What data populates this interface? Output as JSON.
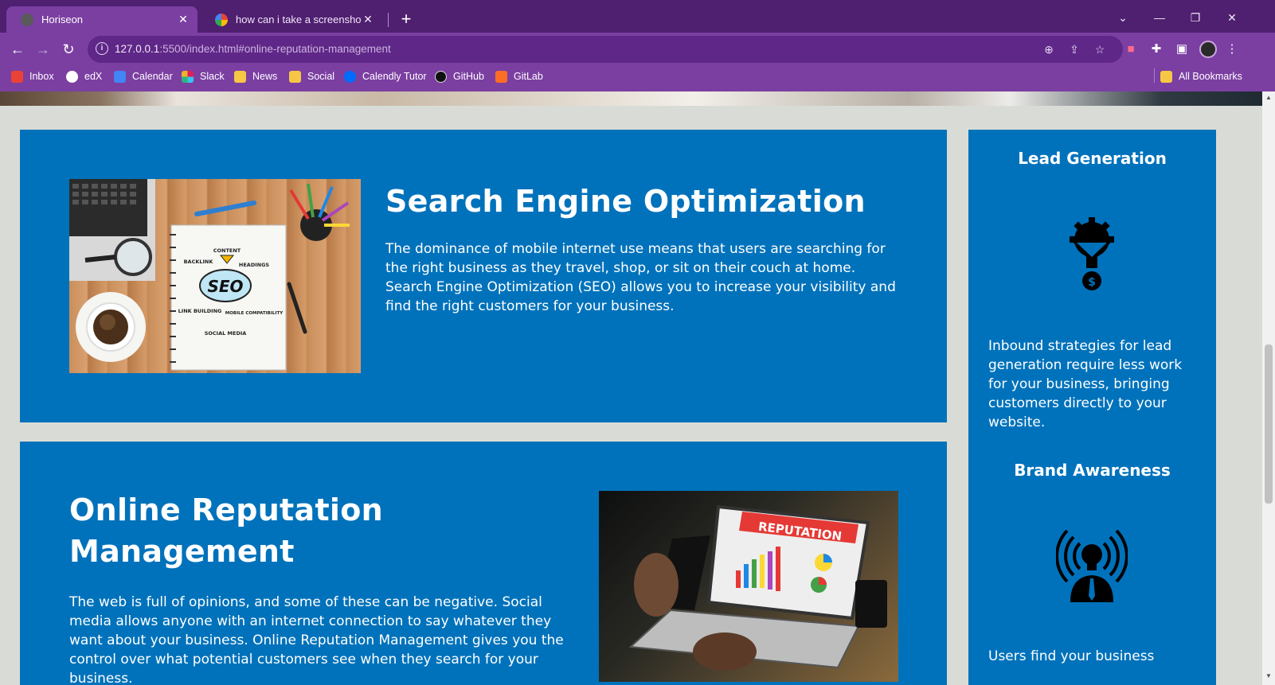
{
  "browser": {
    "tabs": [
      {
        "title": "Horiseon",
        "close": "✕",
        "active": true
      },
      {
        "title": "how can i take a screenshot of m",
        "close": "✕",
        "active": false
      }
    ],
    "new_tab": "+",
    "window_controls": {
      "dropdown": "⌄",
      "minimize": "—",
      "restore": "❐",
      "close": "✕"
    },
    "url": {
      "host": "127.0.0.1",
      "rest": ":5500/index.html#online-reputation-management"
    },
    "bookmarks": [
      {
        "label": "Inbox",
        "icon": "gmail-icon",
        "color": "#ea4335"
      },
      {
        "label": "edX",
        "icon": "edx-icon",
        "color": "#ffffff"
      },
      {
        "label": "Calendar",
        "icon": "calendar-icon",
        "color": "#4285f4"
      },
      {
        "label": "Slack",
        "icon": "slack-icon",
        "color": "#e01e5a"
      },
      {
        "label": "News",
        "icon": "folder-icon",
        "color": "#f6c744"
      },
      {
        "label": "Social",
        "icon": "folder-icon",
        "color": "#f6c744"
      },
      {
        "label": "Calendly Tutor",
        "icon": "calendly-icon",
        "color": "#006bff"
      },
      {
        "label": "GitHub",
        "icon": "github-icon",
        "color": "#111111"
      },
      {
        "label": "GitLab",
        "icon": "gitlab-icon",
        "color": "#fc6d26"
      }
    ],
    "all_bookmarks": "All Bookmarks",
    "colors": {
      "chrome": "#7b3fa2",
      "tabstrip": "#4f1f70"
    }
  },
  "page": {
    "seo": {
      "title": "Search Engine Optimization",
      "text": "The dominance of mobile internet use means that users are searching for the right business as they travel, shop, or sit on their couch at home. Search Engine Optimization (SEO) allows you to increase your visibility and find the right customers for your business.",
      "image_labels": [
        "CONTENT",
        "BACKLINK",
        "HEADINGS",
        "SEO",
        "LINK BUILDING",
        "MOBILE COMPATIBILITY",
        "SOCIAL MEDIA"
      ]
    },
    "orm": {
      "title": "Online Reputation Management",
      "text": "The web is full of opinions, and some of these can be negative. Social media allows anyone with an internet connection to say whatever they want about your business. Online Reputation Management gives you the control over what potential customers see when they search for your business.",
      "image_label": "REPUTATION"
    },
    "benefits": [
      {
        "title": "Lead Generation",
        "icon": "lead-funnel-icon",
        "text": "Inbound strategies for lead generation require less work for your business, bringing customers directly to your website."
      },
      {
        "title": "Brand Awareness",
        "icon": "lightbulb-broadcast-icon",
        "text": "Users find your business"
      }
    ],
    "colors": {
      "card": "#0072bb",
      "background": "#d9dcd6"
    }
  }
}
